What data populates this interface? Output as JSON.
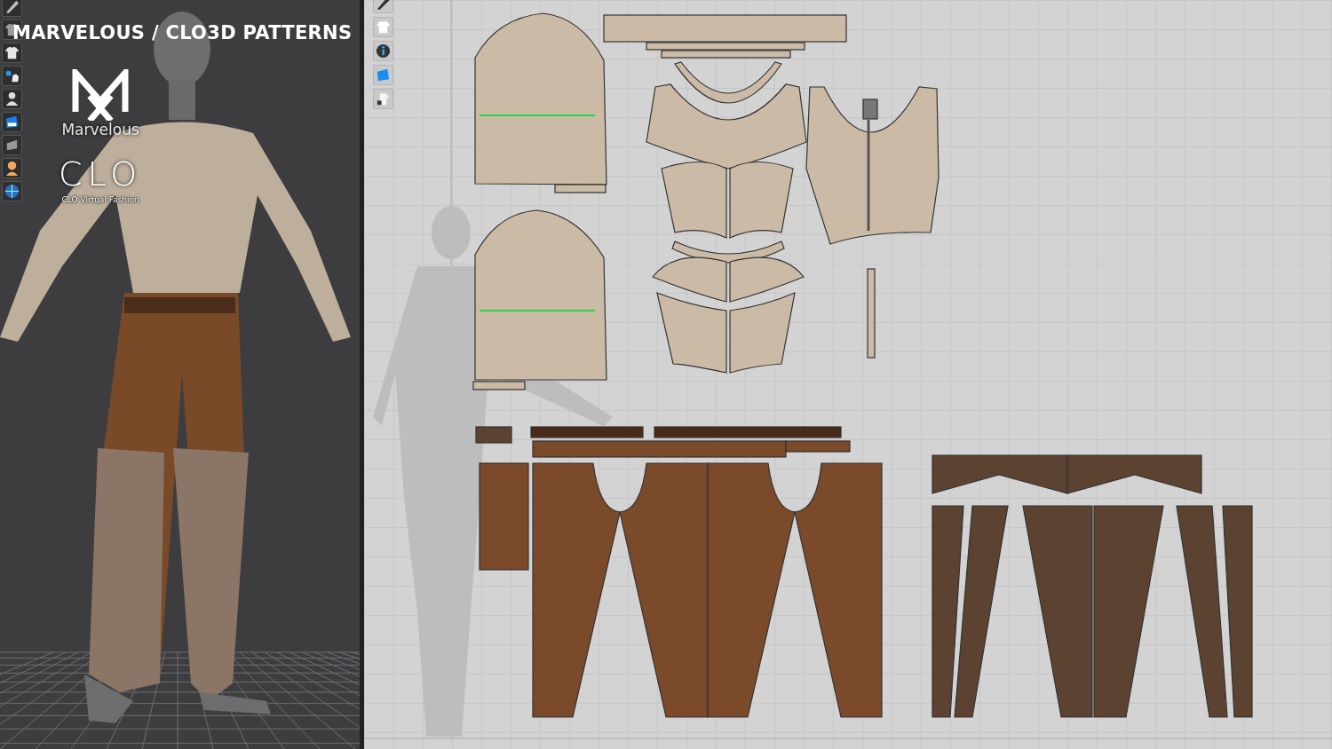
{
  "overlay_title": "MARVELOUS / CLO3D PATTERNS",
  "logos": [
    {
      "kind": "marvelous",
      "wordmark": "Marvelous"
    },
    {
      "kind": "clo",
      "wordmark": "CLO",
      "caption": "CLO Virtual Fashion"
    }
  ]
}
